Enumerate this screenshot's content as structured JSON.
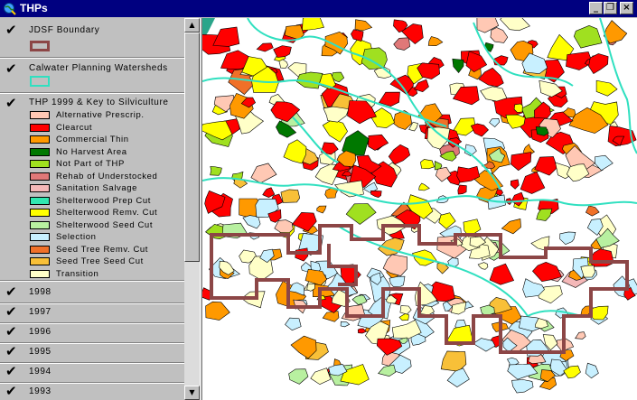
{
  "window": {
    "title": "THPs"
  },
  "toc": {
    "themes": [
      {
        "name": "JDSF Boundary",
        "checked": true
      },
      {
        "name": "Calwater Planning Watersheds",
        "checked": true
      },
      {
        "name": "THP 1999 & Key to Silviculture",
        "checked": true
      }
    ],
    "legend": [
      {
        "label": "Alternative Prescrip.",
        "color": "#ffc8b4"
      },
      {
        "label": "Clearcut",
        "color": "#ff0000"
      },
      {
        "label": "Commercial Thin",
        "color": "#ff9900"
      },
      {
        "label": "No Harvest Area",
        "color": "#007800"
      },
      {
        "label": "Not Part of THP",
        "color": "#a0e020"
      },
      {
        "label": "Rehab of Understocked",
        "color": "#e07878"
      },
      {
        "label": "Sanitation Salvage",
        "color": "#f4b8b8"
      },
      {
        "label": "Shelterwood Prep Cut",
        "color": "#30e8b0"
      },
      {
        "label": "Shelterwood Remv. Cut",
        "color": "#ffff00"
      },
      {
        "label": "Shelterwood Seed Cut",
        "color": "#b8f0a0"
      },
      {
        "label": "Selection",
        "color": "#c8f0ff"
      },
      {
        "label": "Seed Tree Remv. Cut",
        "color": "#f07028"
      },
      {
        "label": "Seed Tree Seed Cut",
        "color": "#f8c038"
      },
      {
        "label": "Transition",
        "color": "#ffffc8"
      }
    ],
    "years": [
      {
        "label": "1998",
        "checked": true
      },
      {
        "label": "1997",
        "checked": true
      },
      {
        "label": "1996",
        "checked": true
      },
      {
        "label": "1995",
        "checked": true
      },
      {
        "label": "1994",
        "checked": true
      },
      {
        "label": "1993",
        "checked": true
      }
    ]
  },
  "colors": {
    "boundary": "#8c4646",
    "watershed": "#30e0c0",
    "title_bar": "#000080",
    "panel": "#c0c0c0"
  }
}
